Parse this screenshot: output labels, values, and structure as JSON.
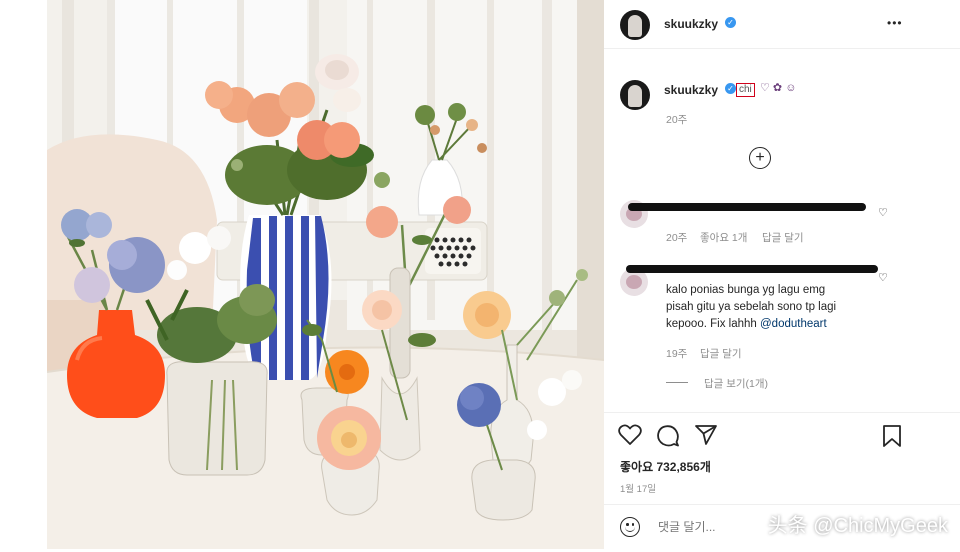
{
  "header": {
    "username": "skuukzky",
    "verified_icon": "verified-badge-icon",
    "more_label": "•••"
  },
  "caption": {
    "username": "skuukzky",
    "tag": "chi",
    "emojis": "♡ ✿ ☺",
    "time": "20주"
  },
  "load_more_icon": "plus-circle-icon",
  "comments": [
    {
      "likes_count": "좋아요 1개",
      "reply_label": "답글 달기",
      "time": "20주"
    },
    {
      "text_line1": "kalo ponias bunga yg lagu emg",
      "text_line2": "pisah gitu ya sebelah sono tp lagi",
      "text_line3": "kepooo. Fix lahhh",
      "mention": "@dodutheart",
      "time": "19주",
      "reply_label": "답글 달기",
      "view_replies": "답글 보기(1개)"
    }
  ],
  "actions": {
    "like_icon": "heart-icon",
    "comment_icon": "comment-icon",
    "share_icon": "send-icon",
    "save_icon": "bookmark-icon"
  },
  "likes": "좋아요 732,856개",
  "post_date": "1월 17일",
  "comment_input": {
    "placeholder": "댓글 달기..."
  },
  "watermark": "头条 @ChicMyGeek",
  "colors": {
    "accent": "#3897f0",
    "text": "#262626",
    "muted": "#8e8e8e",
    "vase_orange": "#ff4e1a",
    "vase_blue": "#3b4fb0",
    "tag_border": "#d0021b"
  }
}
